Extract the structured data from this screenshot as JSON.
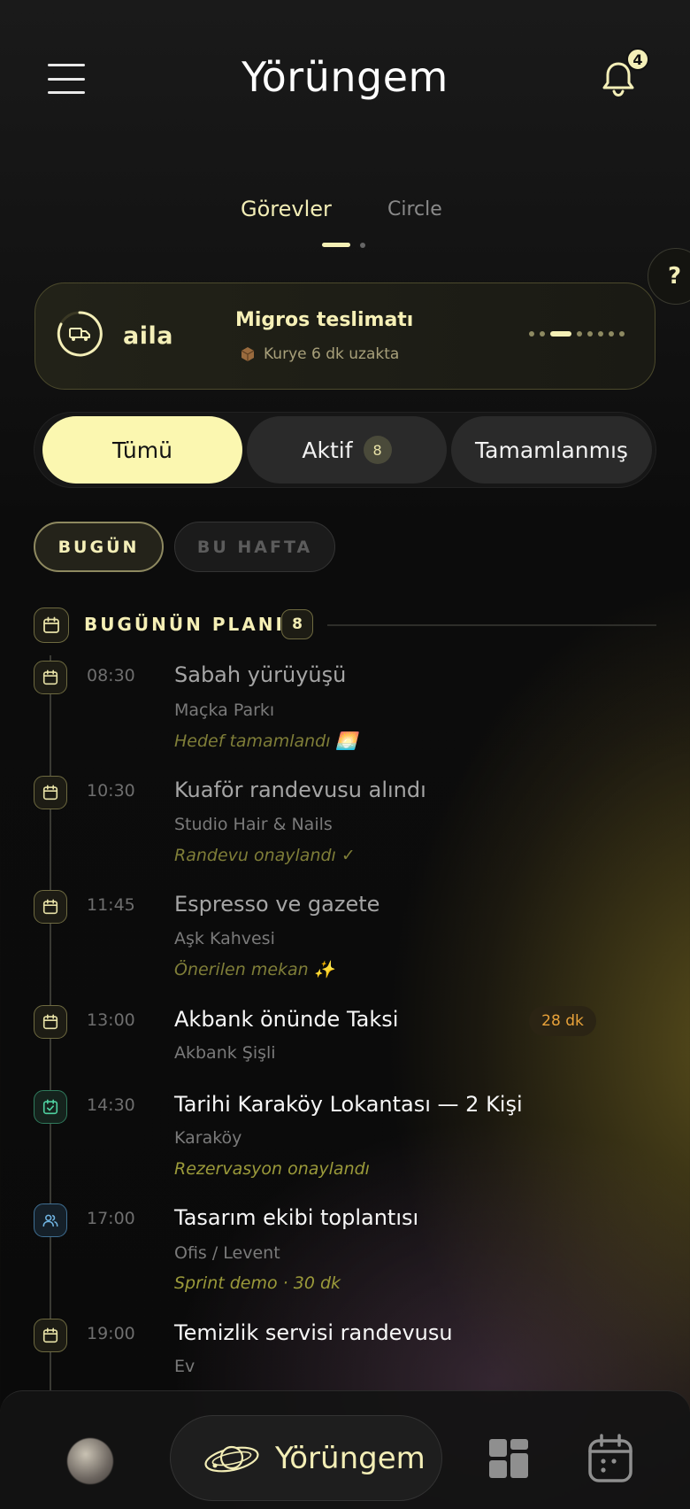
{
  "header": {
    "title": "Yörüngem",
    "notification_count": "4",
    "menu_icon": "hamburger-menu-icon",
    "bell_icon": "bell-icon"
  },
  "top_tabs": [
    {
      "label": "Görevler",
      "active": true
    },
    {
      "label": "Circle",
      "active": false
    }
  ],
  "help_label": "?",
  "aila_card": {
    "brand": "aila",
    "title": "Migros teslimatı",
    "subtitle": "Kurye 6 dk uzakta",
    "icon": "delivery-truck-icon",
    "sub_icon": "package-icon",
    "dots_total": 8,
    "dot_active_index": 2
  },
  "filters": {
    "all_label": "Tümü",
    "active_label": "Aktif",
    "active_count": "8",
    "done_label": "Tamamlanmış"
  },
  "day_chips": {
    "today": "BUGÜN",
    "week": "BU HAFTA"
  },
  "plan": {
    "title": "BUGÜNÜN PLANI",
    "count": "8"
  },
  "events": [
    {
      "time": "08:30",
      "title": "Sabah yürüyüşü",
      "place": "Maçka Parkı",
      "note": "Hedef tamamlandı 🌅",
      "icon": "calendar-icon"
    },
    {
      "time": "10:30",
      "title": "Kuaför randevusu alındı",
      "place": "Studio Hair & Nails",
      "note": "Randevu onaylandı ✓",
      "icon": "calendar-icon"
    },
    {
      "time": "11:45",
      "title": "Espresso ve gazete",
      "place": "Aşk Kahvesi",
      "note": "Önerilen mekan ✨",
      "icon": "calendar-icon"
    },
    {
      "time": "13:00",
      "title": "Akbank önünde Taksi",
      "place": "Akbank Şişli",
      "badge": "28 dk",
      "icon": "calendar-icon"
    },
    {
      "time": "14:30",
      "title": "Tarihi Karaköy Lokantası — 2 Kişi",
      "place": "Karaköy",
      "note": "Rezervasyon onaylandı",
      "icon": "checkbox-icon"
    },
    {
      "time": "17:00",
      "title": "Tasarım ekibi toplantısı",
      "place": "Ofis / Levent",
      "note": "Sprint demo · 30 dk",
      "icon": "people-icon"
    },
    {
      "time": "19:00",
      "title": "Temizlik servisi randevusu",
      "place": "Ev",
      "icon": "calendar-icon"
    }
  ],
  "bottom_nav": {
    "main_label": "Yörüngem",
    "main_icon": "orbit-planet-icon",
    "grid_icon": "dashboard-grid-icon",
    "calendar_icon": "calendar-nav-icon",
    "avatar": "profile-avatar"
  },
  "colors": {
    "accent": "#fbf7b0",
    "accent_text": "#f4efb8",
    "note_green": "#9b9a3a",
    "badge_orange": "#e8a23a"
  }
}
